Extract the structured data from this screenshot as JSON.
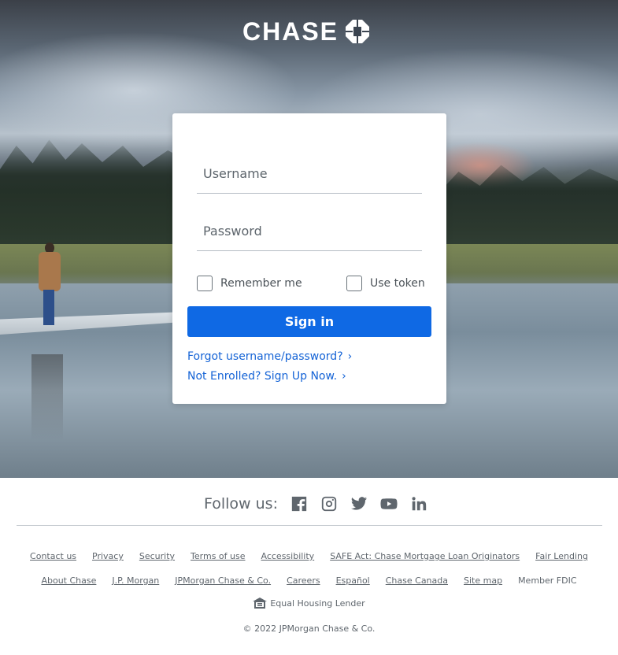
{
  "brand": {
    "name": "CHASE",
    "logo_mark": "chase-octagon-icon"
  },
  "login": {
    "username_placeholder": "Username",
    "password_placeholder": "Password",
    "remember_label": "Remember me",
    "token_label": "Use token",
    "signin_label": "Sign in",
    "forgot_label": "Forgot username/password?",
    "enroll_label": "Not Enrolled? Sign Up Now."
  },
  "footer": {
    "follow_label": "Follow us:",
    "social": [
      "facebook-icon",
      "instagram-icon",
      "twitter-icon",
      "youtube-icon",
      "linkedin-icon"
    ],
    "links_row1": [
      "Contact us",
      "Privacy",
      "Security",
      "Terms of use",
      "Accessibility",
      "SAFE Act: Chase Mortgage Loan Originators",
      "Fair Lending"
    ],
    "links_row2": [
      "About Chase",
      "J.P. Morgan",
      "JPMorgan Chase & Co.",
      "Careers",
      "Español",
      "Chase Canada",
      "Site map"
    ],
    "member_fdic": "Member FDIC",
    "housing_label": "Equal Housing Lender",
    "copyright": "© 2022 JPMorgan Chase & Co."
  },
  "colors": {
    "accent": "#0f69e4",
    "link": "#1463d6",
    "footer_text": "#5f666d"
  }
}
